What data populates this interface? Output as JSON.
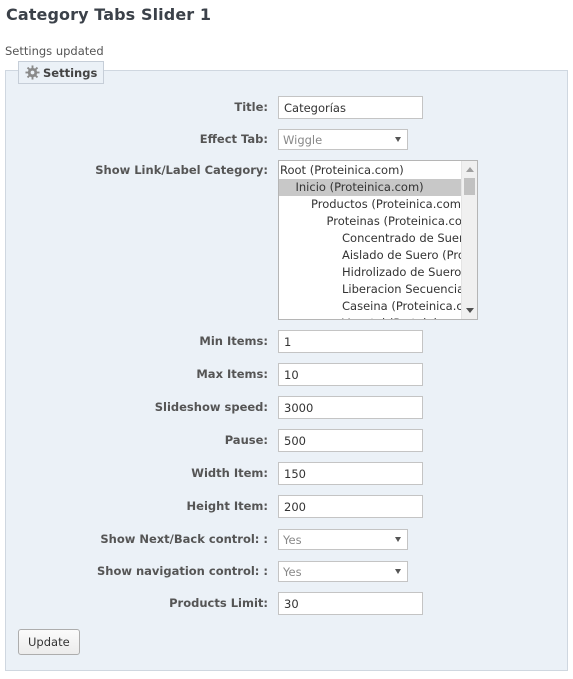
{
  "page": {
    "title": "Category Tabs Slider 1",
    "status": "Settings updated"
  },
  "fieldset": {
    "legend": "Settings",
    "legend_icon": "gear-icon"
  },
  "form": {
    "title": {
      "label": "Title:",
      "value": "Categorías"
    },
    "effect_tab": {
      "label": "Effect Tab:",
      "value": "Wiggle"
    },
    "show_link": {
      "label": "Show Link/Label Category:",
      "options": [
        {
          "text": "Root (Proteinica.com)",
          "level": 0,
          "selected": false
        },
        {
          "text": "Inicio (Proteinica.com)",
          "level": 1,
          "selected": true
        },
        {
          "text": "Productos (Proteinica.com)",
          "level": 2,
          "selected": false
        },
        {
          "text": "Proteinas (Proteinica.com)",
          "level": 3,
          "selected": false
        },
        {
          "text": "Concentrado de Suero (Proteinica.com)",
          "level": 4,
          "selected": false
        },
        {
          "text": "Aislado de Suero (Proteinica.com)",
          "level": 4,
          "selected": false
        },
        {
          "text": "Hidrolizado de Suero (Proteinica.com)",
          "level": 4,
          "selected": false
        },
        {
          "text": "Liberacion Secuencial (Proteinica.com)",
          "level": 4,
          "selected": false
        },
        {
          "text": "Caseina (Proteinica.com)",
          "level": 4,
          "selected": false
        },
        {
          "text": "Vegetal (Proteinica.com)",
          "level": 4,
          "selected": false
        }
      ]
    },
    "min_items": {
      "label": "Min Items:",
      "value": "1"
    },
    "max_items": {
      "label": "Max Items:",
      "value": "10"
    },
    "slideshow_speed": {
      "label": "Slideshow speed:",
      "value": "3000"
    },
    "pause": {
      "label": "Pause:",
      "value": "500"
    },
    "width_item": {
      "label": "Width Item:",
      "value": "150"
    },
    "height_item": {
      "label": "Height Item:",
      "value": "200"
    },
    "show_next_back": {
      "label": "Show Next/Back control: :",
      "value": "Yes"
    },
    "show_navigation": {
      "label": "Show navigation control: :",
      "value": "Yes"
    },
    "products_limit": {
      "label": "Products Limit:",
      "value": "30"
    },
    "update_button": "Update"
  },
  "colors": {
    "panel_background": "#ebf1f7",
    "selected_option": "#c8c8c8"
  }
}
